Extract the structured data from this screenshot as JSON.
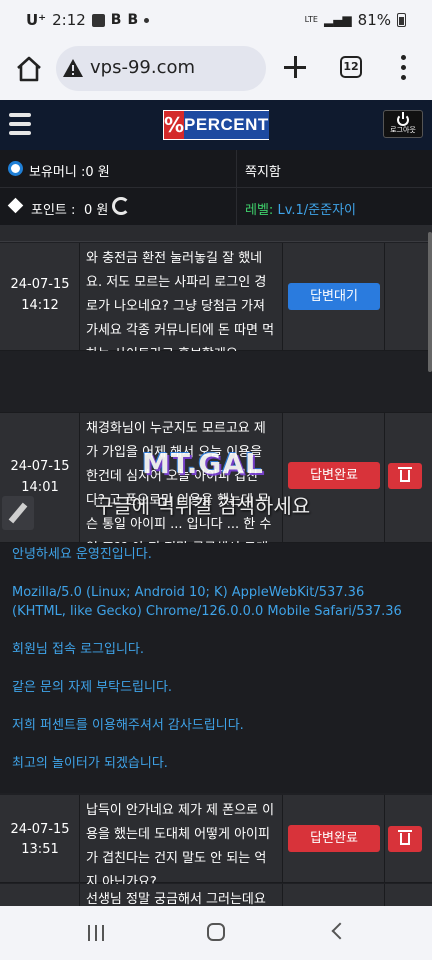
{
  "status_bar": {
    "carrier": "U⁺",
    "time": "2:12",
    "signal_label": "LTE",
    "battery": "81%"
  },
  "browser": {
    "url": "vps-99.com",
    "tab_count": "12"
  },
  "site": {
    "logo_symbol": "%",
    "logo_text": "PERCENT",
    "logout_label": "로그아웃"
  },
  "info": {
    "money_label": "보유머니 :0 원",
    "message_label": "쪽지함",
    "points_label": "포인트 :",
    "points_value": "0 원",
    "level_label": "레벨:",
    "level_value": "Lv.1/준준자이"
  },
  "table": {
    "rows": [
      {
        "date": "24-07-15",
        "time": "14:12",
        "content": "와 충전금 환전 눌러놓길 잘 했네요. 저도 모르는 사파리 로그인 경로가 나오네요? 그냥 당첨금 가져가세요 각종 커뮤니티에 돈 따면 먹 하는 사이트라고 홍보할게요.",
        "status": "답변대기"
      },
      {
        "date": "24-07-15",
        "time": "14:01",
        "content": "채경화님이 누군지도 모르고요 제가 가입을 어제 해서 오늘 이용을 한건데 심지어 오늘 아이피 겹친다? 고 폰으로만 이용을 했는데 무슨 통일 아이피 ... 입니다 ... 한 수 있 죠?? 아 저 정말 궁금해서 그래요",
        "status": "답변완료"
      },
      {
        "date": "24-07-15",
        "time": "13:51",
        "content": "납득이 안가네요 제가 제 폰으로 이용을 했는데 도대체 어떻게 아이피가 겹친다는 건지 말도 안 되는 억지 아닌가요?",
        "status": "답변완료"
      },
      {
        "content": "선생님 정말 궁금해서 그러는데요"
      }
    ],
    "reply": {
      "greeting": "안녕하세요 운영진입니다.",
      "user_agent": "Mozilla/5.0 (Linux; Android 10; K) AppleWebKit/537.36 (KHTML, like Gecko) Chrome/126.0.0.0 Mobile Safari/537.36",
      "line1": "회원님 접속 로그입니다.",
      "line2": "같은 문의 자제 부탁드립니다.",
      "line3": "저희 퍼센트를 이용해주셔서 감사드립니다.",
      "line4": "최고의 놀이터가 되겠습니다."
    }
  },
  "watermark": {
    "logo": "MT.GAL",
    "text": "구글에 먹튀갤 검색하세요"
  },
  "colors": {
    "wait": "#2a7bde",
    "done": "#d8333a",
    "reply_text": "#3fa3e8",
    "header_bg": "#0f1a2e"
  }
}
